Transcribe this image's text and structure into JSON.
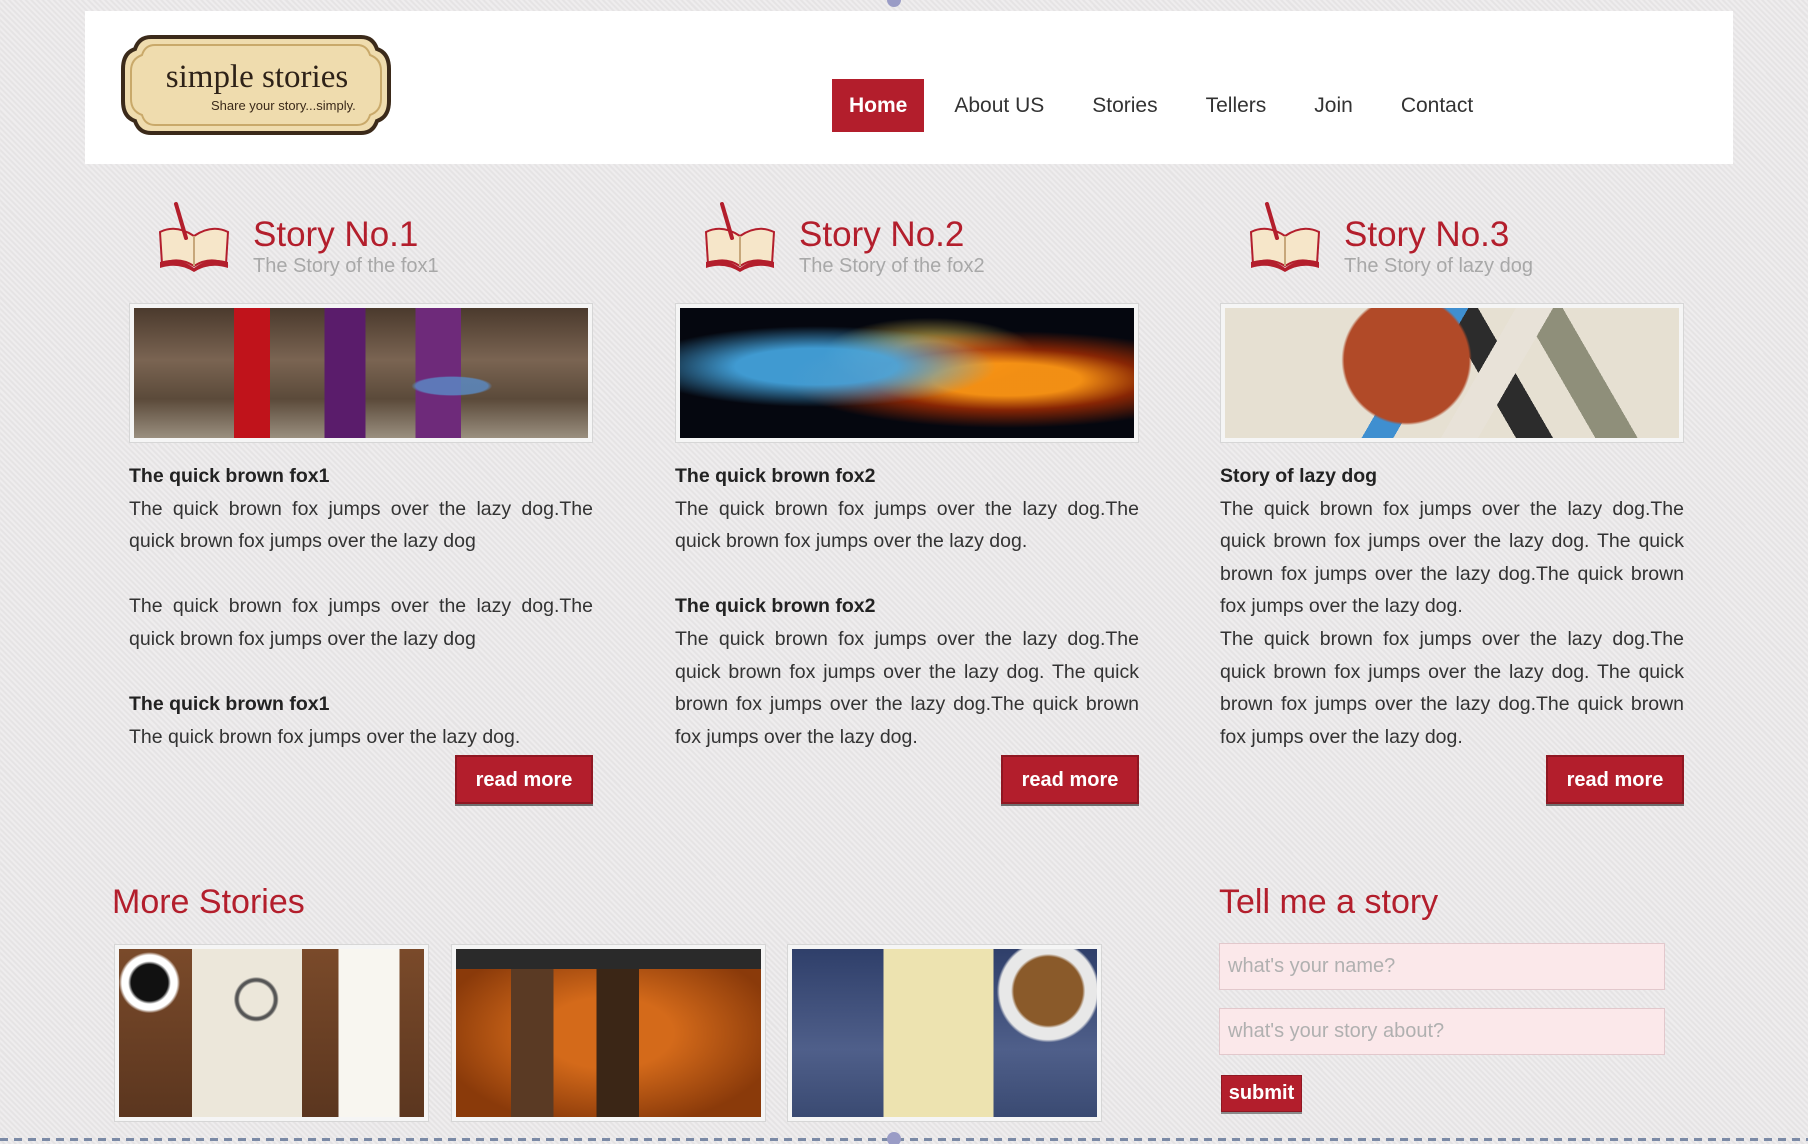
{
  "logo": {
    "name": "simple stories",
    "tagline": "Share your story...simply."
  },
  "nav": {
    "items": [
      {
        "label": "Home",
        "active": true
      },
      {
        "label": "About US"
      },
      {
        "label": "Stories"
      },
      {
        "label": "Tellers"
      },
      {
        "label": "Join"
      },
      {
        "label": "Contact"
      }
    ]
  },
  "stories": [
    {
      "title": "Story No.1",
      "subtitle": "The Story of the fox1",
      "image_icon": "room-image",
      "heading1": "The quick brown fox1",
      "para1": "The quick brown fox jumps over the lazy dog.The quick brown fox jumps over the lazy dog",
      "para2": "The quick brown fox jumps over the lazy dog.The quick brown fox jumps over the lazy dog",
      "heading2": "The quick brown fox1",
      "para3": "The quick brown fox jumps over the lazy dog.",
      "button": "read more"
    },
    {
      "title": "Story No.2",
      "subtitle": "The Story of the fox2",
      "image_icon": "space-image",
      "heading1": "The quick brown fox2",
      "para1": "The quick brown fox jumps over the lazy dog.The quick brown fox jumps over the lazy dog.",
      "heading2": "The quick brown fox2",
      "para2": "The quick brown fox jumps over the lazy dog.The quick brown fox jumps over the lazy dog. The quick brown fox jumps over the lazy dog.The quick brown fox jumps over the lazy dog.",
      "button": "read more"
    },
    {
      "title": "Story No.3",
      "subtitle": "The Story of lazy dog",
      "image_icon": "abstract-image",
      "heading1": "Story of lazy dog",
      "para1": "The quick brown fox jumps over the lazy dog.The quick brown fox jumps over the lazy dog. The quick brown fox jumps over the lazy dog.The quick brown fox jumps over the lazy dog.",
      "para2": "The quick brown fox jumps over the lazy dog.The quick brown fox jumps over the lazy dog. The quick brown fox jumps over the lazy dog.The quick brown fox jumps over the lazy dog.",
      "button": "read more"
    }
  ],
  "more_stories": {
    "title": "More Stories",
    "thumbs": [
      "map-desk-image",
      "leather-desk-image",
      "sketchbook-image"
    ]
  },
  "tell": {
    "title": "Tell me a story",
    "name_placeholder": "what's your name?",
    "about_placeholder": "what's your story about?",
    "submit": "submit"
  },
  "colors": {
    "accent": "#b31e2c",
    "input_bg": "#fbe8ea",
    "page_bg": "#e9e7e8"
  }
}
